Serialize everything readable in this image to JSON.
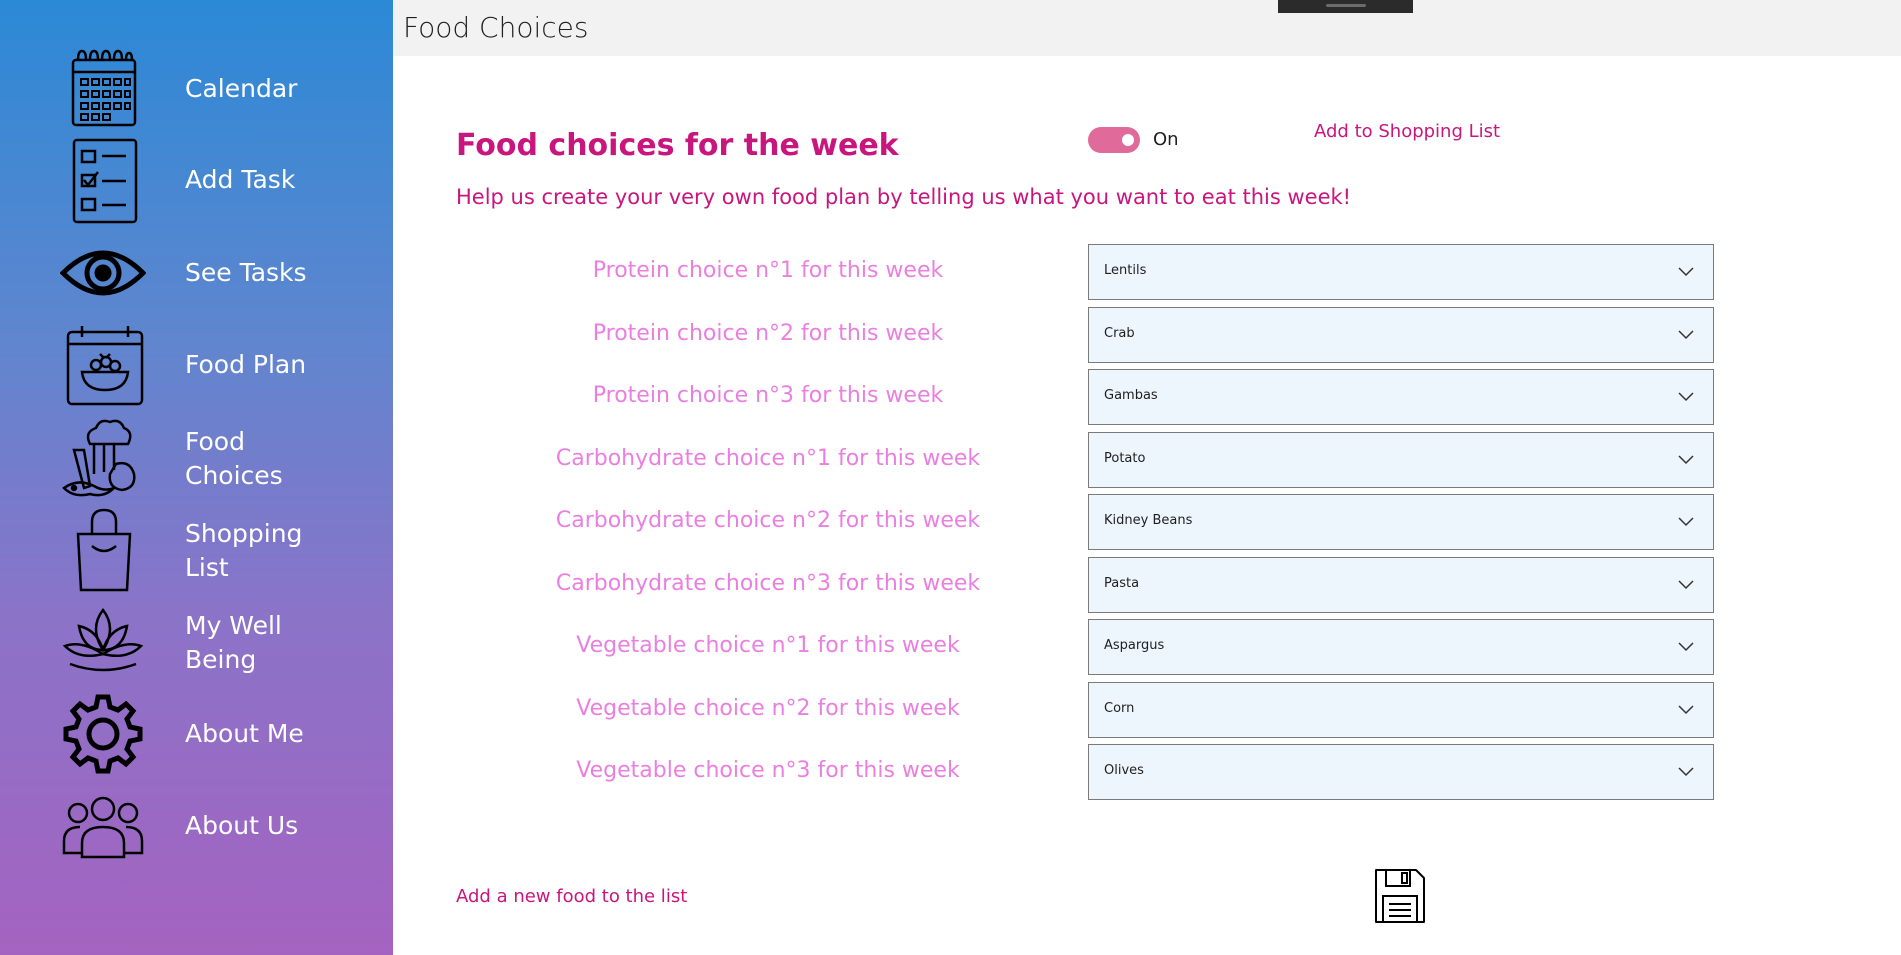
{
  "window": {
    "title": "Food Choices"
  },
  "sidebar": {
    "items": [
      {
        "label": "Calendar",
        "icon": "calendar-icon"
      },
      {
        "label": "Add Task",
        "icon": "checklist-icon"
      },
      {
        "label": "See Tasks",
        "icon": "eye-icon"
      },
      {
        "label": "Food Plan",
        "icon": "food-calendar-icon"
      },
      {
        "label": "Food Choices",
        "icon": "vegetables-icon"
      },
      {
        "label": "Shopping List",
        "icon": "shopping-bag-icon"
      },
      {
        "label": "My Well Being",
        "icon": "lotus-icon"
      },
      {
        "label": "About Me",
        "icon": "gear-icon"
      },
      {
        "label": "About Us",
        "icon": "group-icon"
      }
    ]
  },
  "main": {
    "heading": "Food choices for the week",
    "subheading": "Help us create your very own food plan by telling us what you want to eat this week!",
    "toggle": {
      "state": "On",
      "on": true
    },
    "add_to_shopping_list": "Add to Shopping List",
    "choices": [
      {
        "label": "Protein choice n°1 for this week",
        "value": "Lentils"
      },
      {
        "label": "Protein choice n°2 for this week",
        "value": "Crab"
      },
      {
        "label": "Protein choice n°3 for this week",
        "value": "Gambas"
      },
      {
        "label": "Carbohydrate choice n°1 for this week",
        "value": "Potato"
      },
      {
        "label": "Carbohydrate choice n°2 for this week",
        "value": "Kidney Beans"
      },
      {
        "label": "Carbohydrate choice n°3 for this week",
        "value": "Pasta"
      },
      {
        "label": "Vegetable choice n°1 for this week",
        "value": "Aspargus"
      },
      {
        "label": "Vegetable choice  n°2 for this week",
        "value": "Corn"
      },
      {
        "label": "Vegetable choice n°3 for this week",
        "value": "Olives"
      }
    ],
    "add_food_link": "Add a new  food to the list",
    "save_icon": "floppy-disk-icon"
  },
  "colors": {
    "accent": "#c8167e",
    "label_pink": "#ea7fe0",
    "toggle_on": "#e06a9a",
    "select_bg": "#edf5fd",
    "sidebar_top": "#2b89d6",
    "sidebar_bottom": "#a463c0"
  }
}
